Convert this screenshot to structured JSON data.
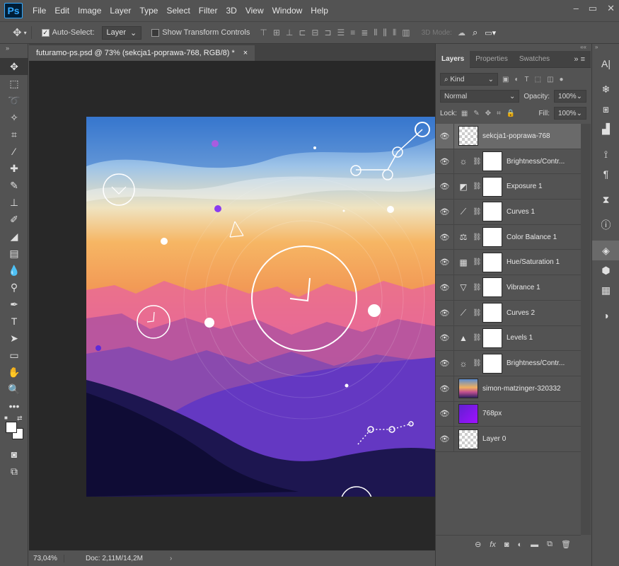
{
  "app": {
    "logo": "Ps"
  },
  "menu": [
    "File",
    "Edit",
    "Image",
    "Layer",
    "Type",
    "Select",
    "Filter",
    "3D",
    "View",
    "Window",
    "Help"
  ],
  "window_controls": [
    "–",
    "▭",
    "✕"
  ],
  "options": {
    "auto_select_label": "Auto-Select:",
    "auto_select_value": "Layer",
    "show_transform_label": "Show Transform Controls",
    "mode_3d_label": "3D Mode:"
  },
  "document": {
    "tab_title": "futuramo-ps.psd @ 73% (sekcja1-poprawa-768, RGB/8) *",
    "close_glyph": "×"
  },
  "status": {
    "zoom": "73,04%",
    "doc_size": "Doc: 2,11M/14,2M",
    "arrow": "›"
  },
  "layers_panel": {
    "tabs": [
      "Layers",
      "Properties",
      "Swatches"
    ],
    "filter_kind": "Kind",
    "blend_mode": "Normal",
    "opacity_label": "Opacity:",
    "opacity_value": "100%",
    "lock_label": "Lock:",
    "fill_label": "Fill:",
    "fill_value": "100%",
    "layers": [
      {
        "name": "sekcja1-poprawa-768",
        "type": "group",
        "icon": "checker-thumb",
        "selected": true
      },
      {
        "name": "Brightness/Contr...",
        "type": "adjustment",
        "icon": "sun-icon"
      },
      {
        "name": "Exposure 1",
        "type": "adjustment",
        "icon": "exposure-icon"
      },
      {
        "name": "Curves 1",
        "type": "adjustment",
        "icon": "curves-icon"
      },
      {
        "name": "Color Balance 1",
        "type": "adjustment",
        "icon": "balance-icon"
      },
      {
        "name": "Hue/Saturation 1",
        "type": "adjustment",
        "icon": "hue-sat-icon"
      },
      {
        "name": "Vibrance 1",
        "type": "adjustment",
        "icon": "vibrance-icon"
      },
      {
        "name": "Curves 2",
        "type": "adjustment",
        "icon": "curves-icon"
      },
      {
        "name": "Levels 1",
        "type": "adjustment",
        "icon": "levels-icon"
      },
      {
        "name": "Brightness/Contr...",
        "type": "adjustment",
        "icon": "sun-icon"
      },
      {
        "name": "simon-matzinger-320332",
        "type": "image",
        "icon": "photo-thumb"
      },
      {
        "name": "768px",
        "type": "image",
        "icon": "purple-thumb"
      },
      {
        "name": "Layer 0",
        "type": "image",
        "icon": "checker-thumb"
      }
    ]
  },
  "colors": {
    "accent": "#31a8ff",
    "panel_bg": "#535353",
    "canvas_bg": "#282828",
    "selected_layer": "#6a6a6a"
  }
}
